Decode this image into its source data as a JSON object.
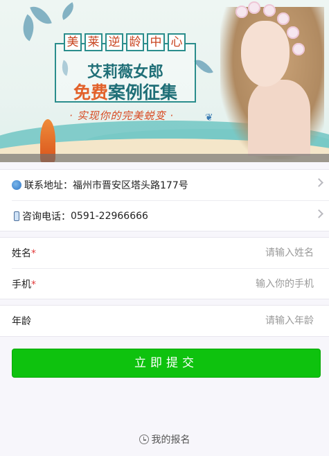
{
  "banner": {
    "header_chars": [
      "美",
      "莱",
      "逆",
      "龄",
      "中",
      "心"
    ],
    "title_line1": "艾莉薇女郎",
    "title_line2_a": "免费",
    "title_line2_b": "案例征集",
    "slogan": "· 实现你的完美蜕变 ·"
  },
  "info": {
    "address_label": "联系地址：",
    "address_value": "福州市晋安区塔头路177号",
    "phone_label": "咨询电话：",
    "phone_value": "0591-22966666"
  },
  "form": {
    "name_label": "姓名",
    "name_placeholder": "请输入姓名",
    "mobile_label": "手机",
    "mobile_placeholder": "输入你的手机",
    "age_label": "年龄",
    "age_placeholder": "请输入年龄",
    "required_mark": "*"
  },
  "submit_label": "立即提交",
  "my_signup_label": "我的报名",
  "colors": {
    "submit_bg": "#0ec20e",
    "required": "#e23c3c",
    "title_teal": "#1f6f77",
    "title_orange": "#e2612a"
  },
  "icons": [
    "location-pin-icon",
    "phone-icon",
    "chevron-right-icon",
    "clock-icon",
    "leaf-icon",
    "butterfly-icon"
  ]
}
